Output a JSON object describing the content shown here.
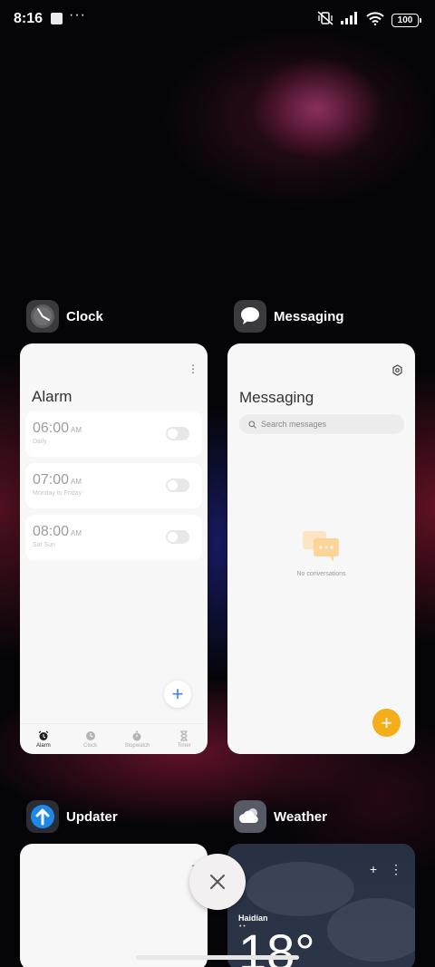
{
  "status_bar": {
    "time": "8:16",
    "dots": "···",
    "battery": "100"
  },
  "recents": {
    "apps": [
      {
        "name": "Clock",
        "card": {
          "title": "Alarm",
          "alarms": [
            {
              "time": "06:00",
              "ampm": "AM",
              "repeat": "Daily",
              "enabled": false
            },
            {
              "time": "07:00",
              "ampm": "AM",
              "repeat": "Monday to Friday",
              "enabled": false
            },
            {
              "time": "08:00",
              "ampm": "AM",
              "repeat": "Sat Sun",
              "enabled": false
            }
          ],
          "nav": [
            "Alarm",
            "Clock",
            "Stopwatch",
            "Timer"
          ],
          "add_symbol": "+"
        }
      },
      {
        "name": "Messaging",
        "card": {
          "title": "Messaging",
          "search_placeholder": "Search messages",
          "empty_text": "No conversations",
          "add_symbol": "+"
        }
      },
      {
        "name": "Updater"
      },
      {
        "name": "Weather",
        "card": {
          "city": "Haidian",
          "temperature": "18°",
          "add_symbol": "+"
        }
      }
    ]
  },
  "colors": {
    "accent_blue": "#3b82f6",
    "accent_orange": "#f6ad1a",
    "updater_blue": "#1e88e5"
  }
}
